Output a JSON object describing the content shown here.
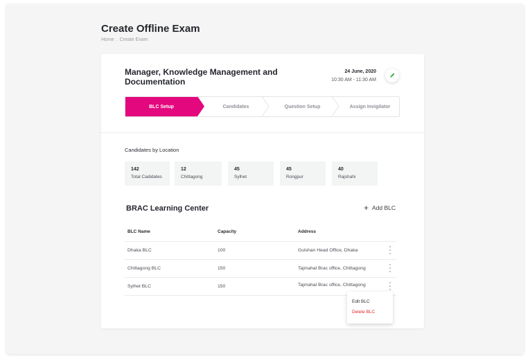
{
  "page": {
    "title": "Create Offline Exam",
    "breadcrumb": [
      "Home",
      ".",
      "Create Exam"
    ]
  },
  "exam": {
    "title": "Manager, Knowledge Management and Documentation",
    "date": "24 June, 2020",
    "time": "10:30 AM - 11:30 AM",
    "edit_icon": "pencil-icon"
  },
  "steps": [
    {
      "label": "BLC Setup",
      "active": true
    },
    {
      "label": "Candidates",
      "active": false
    },
    {
      "label": "Question Setup",
      "active": false
    },
    {
      "label": "Assign Invigilator",
      "active": false
    }
  ],
  "candidates_section": {
    "label": "Candidates by Location",
    "stats": [
      {
        "value": "142",
        "label": "Total Cadidates"
      },
      {
        "value": "12",
        "label": "Chittagong"
      },
      {
        "value": "45",
        "label": "Sylhet"
      },
      {
        "value": "45",
        "label": "Rongpur"
      },
      {
        "value": "40",
        "label": "Rajshahi"
      }
    ]
  },
  "blc": {
    "title": "BRAC Learning Center",
    "add_label": "Add BLC",
    "columns": [
      "BLC Name",
      "Capacity",
      "Address"
    ],
    "rows": [
      {
        "name": "Dhaka BLC",
        "capacity": "100",
        "address": "Gulshan Head Office, Dhaka"
      },
      {
        "name": "Chittagong BLC",
        "capacity": "150",
        "address": "Tajmahal Brac office, Chittagong"
      },
      {
        "name": "Sylhet BLC",
        "capacity": "150",
        "address": "Tajmahal Brac office, Chittagong"
      }
    ]
  },
  "context_menu": {
    "edit_label": "Edit BLC",
    "delete_label": "Delete BLC"
  },
  "colors": {
    "accent": "#e4087f",
    "danger": "#e0262a",
    "edit_icon": "#2fae3a"
  }
}
